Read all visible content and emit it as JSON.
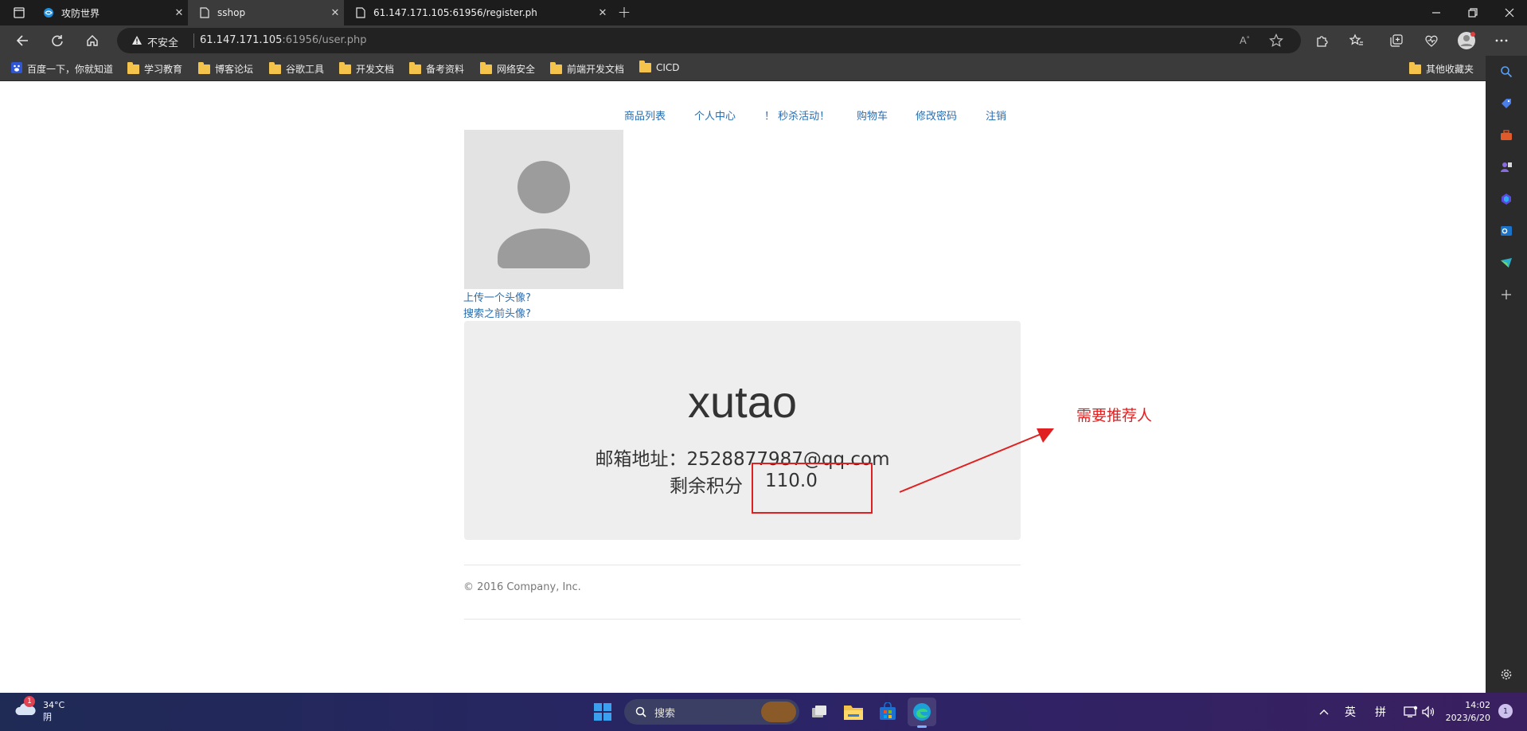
{
  "browser": {
    "tabs": [
      {
        "title": "攻防世界",
        "icon": "globe-icon",
        "active": false
      },
      {
        "title": "sshop",
        "icon": "page-icon",
        "active": true
      },
      {
        "title": "61.147.171.105:61956/register.ph",
        "icon": "page-icon",
        "active": false
      }
    ],
    "insecure_label": "不安全",
    "url_host": "61.147.171.105",
    "url_rest": ":61956/user.php"
  },
  "bookmarks": {
    "items": [
      {
        "label": "百度一下，你就知道",
        "icon": "paw-icon"
      },
      {
        "label": "学习教育",
        "icon": "folder-icon"
      },
      {
        "label": "博客论坛",
        "icon": "folder-icon"
      },
      {
        "label": "谷歌工具",
        "icon": "folder-icon"
      },
      {
        "label": "开发文档",
        "icon": "folder-icon"
      },
      {
        "label": "备考资料",
        "icon": "folder-icon"
      },
      {
        "label": "网络安全",
        "icon": "folder-icon"
      },
      {
        "label": "前端开发文档",
        "icon": "folder-icon"
      },
      {
        "label": "CICD",
        "icon": "folder-icon"
      }
    ],
    "other": "其他收藏夹"
  },
  "page": {
    "nav": [
      "商品列表",
      "个人中心",
      "！ 秒杀活动！",
      "购物车",
      "修改密码",
      "注销"
    ],
    "upload_avatar": "上传一个头像?",
    "search_avatar": "搜索之前头像?",
    "username": "xutao",
    "email_label": "邮箱地址：",
    "email": "2528877987@qq.com",
    "points_label": "剩余积分",
    "points": "110.0",
    "footer": "© 2016 Company, Inc.",
    "annotation": "需要推荐人"
  },
  "taskbar": {
    "weather_temp": "34°C",
    "weather_desc": "阴",
    "weather_badge": "1",
    "search_label": "搜索",
    "ime_lang": "英",
    "ime_mode": "拼",
    "time": "14:02",
    "date": "2023/6/20",
    "notification_count": "1"
  },
  "colors": {
    "link": "#2a6db0",
    "annotation": "#e02020",
    "card_bg": "#eeeeee"
  }
}
